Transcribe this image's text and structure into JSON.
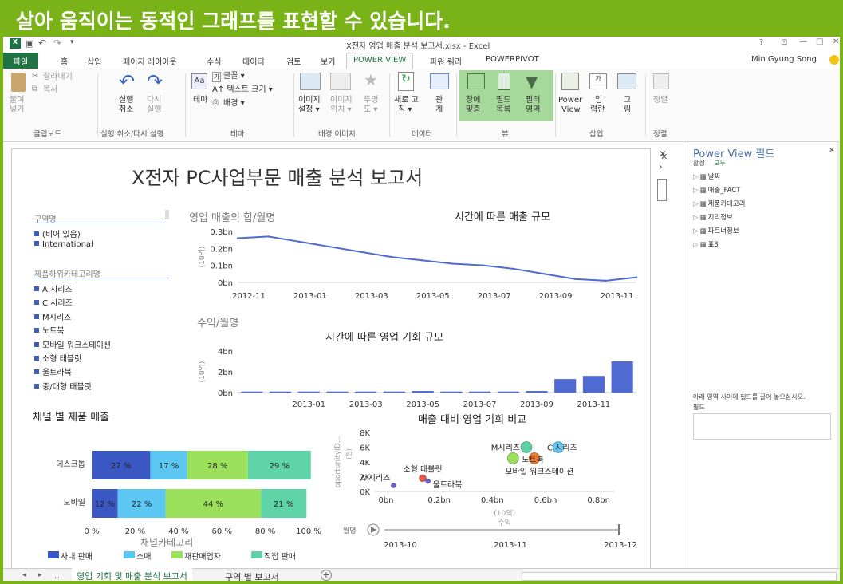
{
  "banner": {
    "title": "살아 움직이는 동적인 그래프를 표현할 수 있습니다."
  },
  "window": {
    "title": "X전자 영업 매출 분석 보고서.xlsx - Excel",
    "user": "Min Gyung Song",
    "qat_icons": [
      "excel-logo-icon",
      "save-icon",
      "undo-icon",
      "redo-icon",
      "customize-icon"
    ]
  },
  "tabs": [
    "파일",
    "홈",
    "삽입",
    "페이지 레이아웃",
    "수식",
    "데이터",
    "검토",
    "보기",
    "POWER VIEW",
    "파워 쿼리",
    "POWERPIVOT"
  ],
  "ribbon": {
    "clipboard": {
      "cut": "잘라내기",
      "copy": "복사",
      "paste1": "붙여",
      "paste2": "넣기",
      "label": "클립보드"
    },
    "undo": {
      "undo1": "실행",
      "undo2": "취소",
      "redo1": "다시",
      "redo2": "실행",
      "label": "실행 취소/다시 실행"
    },
    "theme": {
      "theme": "테마",
      "font": "글꼴 ▾",
      "textsize": "A↑ 텍스트 크기 ▾",
      "bg": "배경 ▾",
      "label": "테마"
    },
    "bgimage": {
      "set1": "이미지",
      "set2": "설정 ▾",
      "pos1": "이미지",
      "pos2": "위치 ▾",
      "tr1": "투명",
      "tr2": "도 ▾",
      "label": "배경 이미지"
    },
    "data": {
      "refresh1": "새로 고",
      "refresh2": "침 ▾",
      "rel1": "관",
      "rel2": "계",
      "label": "데이터"
    },
    "view": {
      "fit1": "창에",
      "fit2": "맞춤",
      "field1": "필드",
      "field2": "목록",
      "filter1": "필터",
      "filter2": "영역",
      "label": "뷰"
    },
    "insert": {
      "pv1": "Power",
      "pv2": "View",
      "in1": "입",
      "in2": "력란",
      "pic1": "그",
      "pic2": "림",
      "label": "삽입"
    },
    "arrange": {
      "arr": "정렬",
      "label": "정렬"
    }
  },
  "report": {
    "title": "X전자 PC사업부문 매출 분석 보고서",
    "region_slicer": {
      "header": "구역명",
      "items": [
        "(비어 있음)",
        "International"
      ]
    },
    "product_slicer": {
      "header": "제품하위카테고리명",
      "items": [
        "A 시리즈",
        "C 시리즈",
        "M시리즈",
        "노트북",
        "모바일 워크스테이션",
        "소형 태블릿",
        "울트라북",
        "중/대형 태블릿"
      ]
    },
    "channel_title": "채널 별 제품 매출",
    "channel_legend_title": "채널카테고리",
    "caption_opp": "수익/월명"
  },
  "chart_data": [
    {
      "type": "line",
      "label": "영업 매출의 합/월명",
      "title": "시간에 따른 매출 규모",
      "ylabel": "(10억)",
      "yticks": [
        "0bn",
        "0.1bn",
        "0.2bn",
        "0.3bn"
      ],
      "ylim": [
        0,
        0.3
      ],
      "x": [
        "2012-11",
        "2012-12",
        "2013-01",
        "2013-02",
        "2013-03",
        "2013-04",
        "2013-05",
        "2013-06",
        "2013-07",
        "2013-08",
        "2013-09",
        "2013-10",
        "2013-11",
        "2013-12"
      ],
      "xticks": [
        "2012-11",
        "2013-01",
        "2013-03",
        "2013-05",
        "2013-07",
        "2013-09",
        "2013-11"
      ],
      "values": [
        0.26,
        0.27,
        0.24,
        0.21,
        0.18,
        0.15,
        0.13,
        0.11,
        0.1,
        0.08,
        0.05,
        0.02,
        0.01,
        0.03
      ],
      "color": "#4f6bd1"
    },
    {
      "type": "bar",
      "title": "시간에 따른 영업 기회 규모",
      "ylabel": "(10억)",
      "yticks": [
        "0bn",
        "2bn",
        "4bn"
      ],
      "ylim": [
        0,
        4
      ],
      "x": [
        "2012-11",
        "2012-12",
        "2013-01",
        "2013-02",
        "2013-03",
        "2013-04",
        "2013-05",
        "2013-06",
        "2013-07",
        "2013-08",
        "2013-09",
        "2013-10",
        "2013-11",
        "2013-12"
      ],
      "xticks": [
        "2013-01",
        "2013-03",
        "2013-05",
        "2013-07",
        "2013-09",
        "2013-11"
      ],
      "values": [
        0.1,
        0.1,
        0.1,
        0.1,
        0.1,
        0.1,
        0.15,
        0.1,
        0.1,
        0.1,
        0.15,
        1.3,
        1.6,
        3.0
      ],
      "color": "#4f6bd1"
    },
    {
      "type": "bar",
      "stacked": true,
      "horizontal": true,
      "categories": [
        "데스크톱",
        "모바일"
      ],
      "xticks": [
        "0 %",
        "20 %",
        "40 %",
        "60 %",
        "80 %",
        "100 %"
      ],
      "series": [
        {
          "name": "사내 판매",
          "values": [
            27,
            12
          ],
          "color": "#3b57c4"
        },
        {
          "name": "소매",
          "values": [
            17,
            22
          ],
          "color": "#5bc7f2"
        },
        {
          "name": "재판매업자",
          "values": [
            28,
            44
          ],
          "color": "#9be05a"
        },
        {
          "name": "직접 판매",
          "values": [
            29,
            21
          ],
          "color": "#5fd3a8"
        }
      ]
    },
    {
      "type": "scatter",
      "title": "매출 대비 영업 기회 비교",
      "xlabel": "(10억)\n수익",
      "ylabel": "pportunityID...",
      "ylabel2": "(한)",
      "xticks": [
        "0bn",
        "0.2bn",
        "0.4bn",
        "0.6bn",
        "0.8bn"
      ],
      "yticks": [
        "0K",
        "2K",
        "4K",
        "6K",
        "8K"
      ],
      "xlim": [
        0,
        0.9
      ],
      "ylim": [
        0,
        8000
      ],
      "points": [
        {
          "label": "A 시리즈",
          "x": 0.07,
          "y": 800,
          "color": "#6b5bd6"
        },
        {
          "label": "소형 태블릿",
          "x": 0.18,
          "y": 1800,
          "color": "#e05b4a"
        },
        {
          "label": "울트라북",
          "x": 0.2,
          "y": 1400,
          "color": "#6b5bd6"
        },
        {
          "label": "M시리즈",
          "x": 0.57,
          "y": 6000,
          "color": "#5fd3a8"
        },
        {
          "label": "C 시리즈",
          "x": 0.69,
          "y": 6000,
          "color": "#5bc7f2"
        },
        {
          "label": "노트북",
          "x": 0.6,
          "y": 4500,
          "color": "#f07a2b"
        },
        {
          "label": "모바일 워크스테이션",
          "x": 0.52,
          "y": 4500,
          "color": "#9be05a"
        }
      ],
      "play": {
        "label": "월명",
        "ticks": [
          "2013-10",
          "2013-11",
          "2013-12"
        ]
      }
    }
  ],
  "fields": {
    "title": "Power View 필드",
    "tab_active": "활성",
    "tab_all": "모두",
    "tables": [
      "날짜",
      "매출_FACT",
      "제품카테고리",
      "지리정보",
      "파트너정보",
      "표3"
    ],
    "hint": "아래 영역 사이에 필드를 끌어 놓으십시오.",
    "area_label": "필드"
  },
  "sheets": [
    "영업 기회 및 매출 분석 보고서",
    "구역 별 보고서"
  ]
}
